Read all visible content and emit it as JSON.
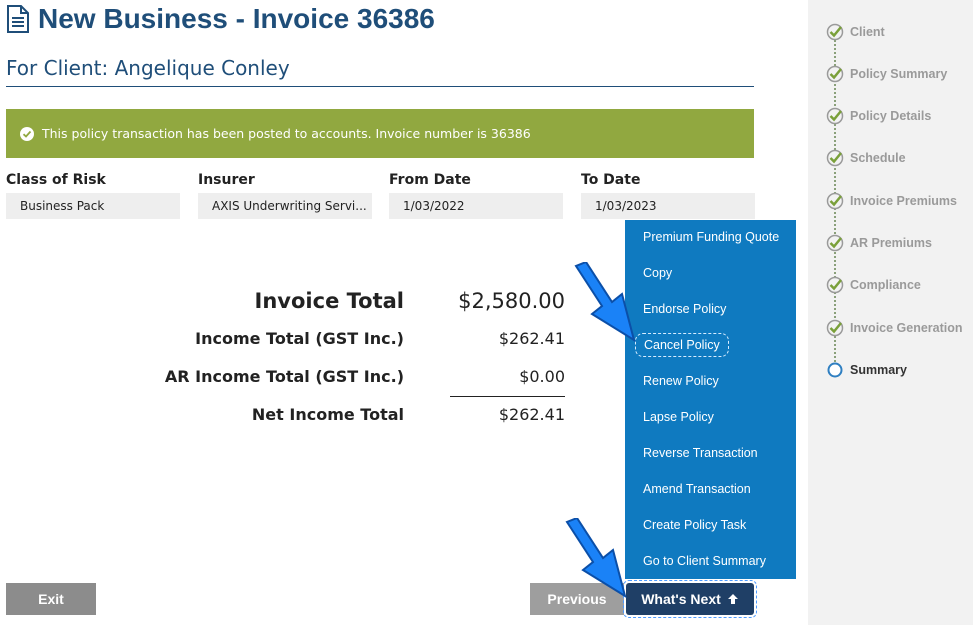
{
  "header": {
    "title": "New Business - Invoice 36386",
    "client_line": "For Client: Angelique Conley"
  },
  "banner": {
    "message": "This policy transaction has been posted to accounts. Invoice number is 36386",
    "color": "#91a840"
  },
  "fields": [
    {
      "label": "Class of Risk",
      "value": "Business Pack"
    },
    {
      "label": "Insurer",
      "value": "AXIS Underwriting Servi..."
    },
    {
      "label": "From Date",
      "value": "1/03/2022"
    },
    {
      "label": "To Date",
      "value": "1/03/2023"
    }
  ],
  "totals": {
    "invoice_total_label": "Invoice Total",
    "invoice_total_value": "$2,580.00",
    "income_total_label": "Income Total (GST Inc.)",
    "income_total_value": "$262.41",
    "ar_income_label": "AR Income Total (GST Inc.)",
    "ar_income_value": "$0.00",
    "net_income_label": "Net Income Total",
    "net_income_value": "$262.41"
  },
  "whats_next_menu": {
    "color": "#0f7ac0",
    "items": [
      "Premium Funding Quote",
      "Copy",
      "Endorse Policy",
      "Cancel Policy",
      "Renew Policy",
      "Lapse Policy",
      "Reverse Transaction",
      "Amend Transaction",
      "Create Policy Task",
      "Go to Client Summary"
    ],
    "highlighted": "Cancel Policy"
  },
  "buttons": {
    "exit": "Exit",
    "previous": "Previous",
    "whats_next": "What's Next"
  },
  "steps": [
    {
      "label": "Client",
      "status": "complete"
    },
    {
      "label": "Policy Summary",
      "status": "complete"
    },
    {
      "label": "Policy Details",
      "status": "complete"
    },
    {
      "label": "Schedule",
      "status": "complete"
    },
    {
      "label": "Invoice Premiums",
      "status": "complete"
    },
    {
      "label": "AR Premiums",
      "status": "complete"
    },
    {
      "label": "Compliance",
      "status": "complete"
    },
    {
      "label": "Invoice Generation",
      "status": "complete"
    },
    {
      "label": "Summary",
      "status": "current"
    }
  ],
  "icons": {
    "title": "document-icon",
    "banner": "check-circle-icon",
    "step_complete": "check-icon",
    "step_current": "circle-icon",
    "whats_next": "arrow-up-icon",
    "pointer": "blue-arrow-icon"
  },
  "colors": {
    "title": "#1f4e79",
    "step_check": "#7aa03a",
    "whats_next_button": "#1f3f66"
  }
}
